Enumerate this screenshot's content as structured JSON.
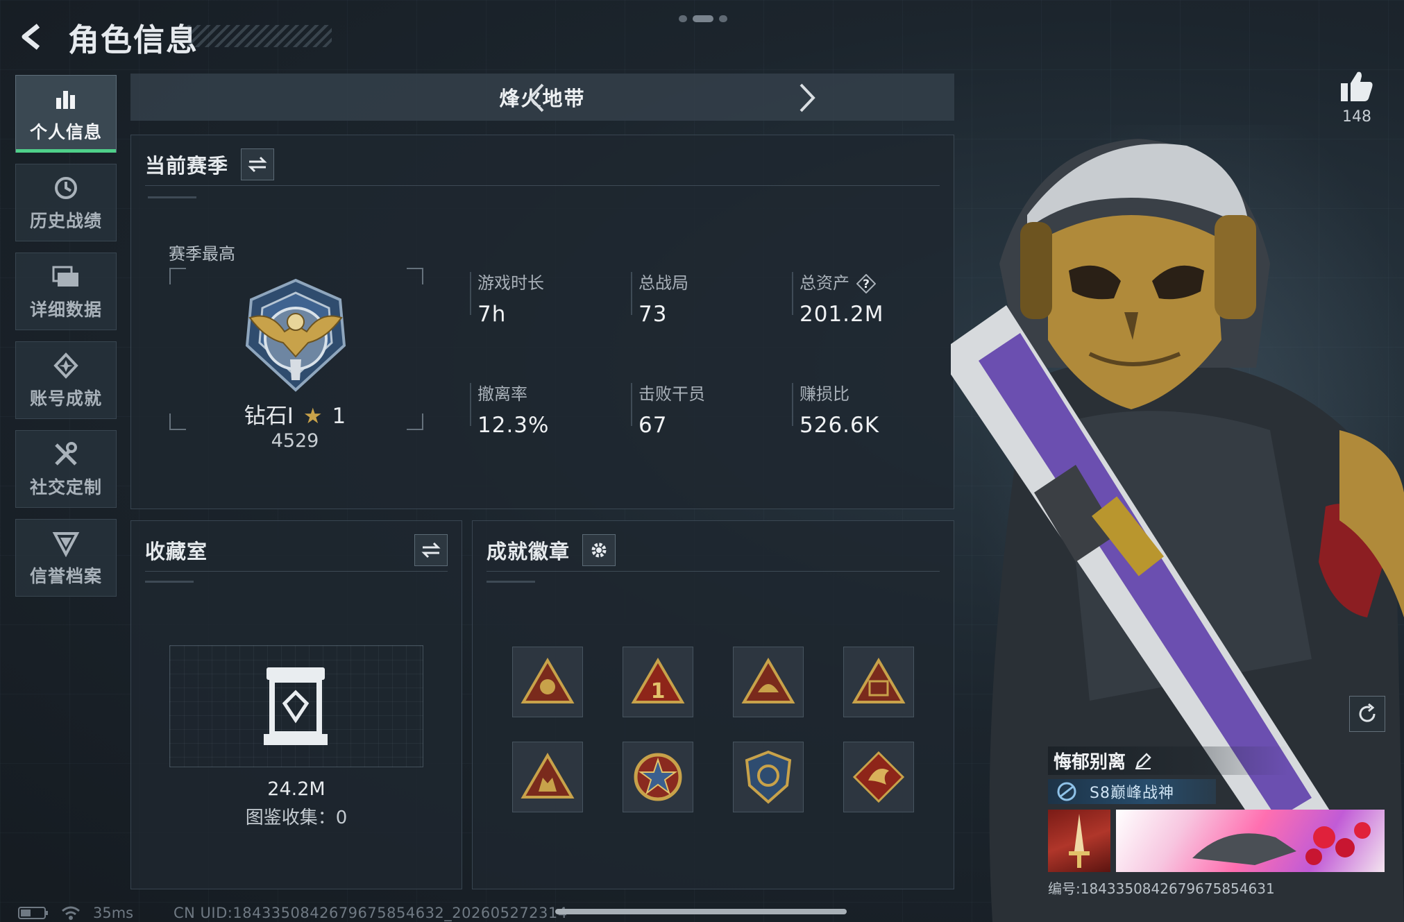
{
  "header": {
    "title": "角色信息"
  },
  "nav": [
    {
      "label": "个人信息",
      "icon": "bar-chart-icon",
      "active": true
    },
    {
      "label": "历史战绩",
      "icon": "history-icon",
      "active": false
    },
    {
      "label": "详细数据",
      "icon": "folder-icon",
      "active": false
    },
    {
      "label": "账号成就",
      "icon": "achievement-icon",
      "active": false
    },
    {
      "label": "社交定制",
      "icon": "tools-icon",
      "active": false
    },
    {
      "label": "信誉档案",
      "icon": "reputation-icon",
      "active": false
    }
  ],
  "mode": {
    "title": "烽火地带"
  },
  "season": {
    "title": "当前赛季",
    "best_label": "赛季最高",
    "rank_name": "钻石I",
    "rank_stars": "1",
    "rank_score": "4529",
    "stats": [
      {
        "label": "游戏时长",
        "value": "7h"
      },
      {
        "label": "总战局",
        "value": "73"
      },
      {
        "label": "总资产",
        "value": "201.2M"
      },
      {
        "label": "撤离率",
        "value": "12.3%"
      },
      {
        "label": "击败干员",
        "value": "67"
      },
      {
        "label": "赚损比",
        "value": "526.6K"
      }
    ]
  },
  "collection": {
    "title": "收藏室",
    "value": "24.2M",
    "count_text": "图鉴收集：0"
  },
  "badges": {
    "title": "成就徽章"
  },
  "like": {
    "count": "148"
  },
  "profile": {
    "name": "悔郁别离",
    "title_tag": "S8巅峰战神",
    "id_text": "编号:1843350842679675854631"
  },
  "status": {
    "ping": "35ms",
    "uid": "CN UID:1843350842679675854632_202605272314"
  },
  "colors": {
    "accent": "#4fd08a",
    "gold": "#c8a24a",
    "panel": "#1e272f"
  }
}
